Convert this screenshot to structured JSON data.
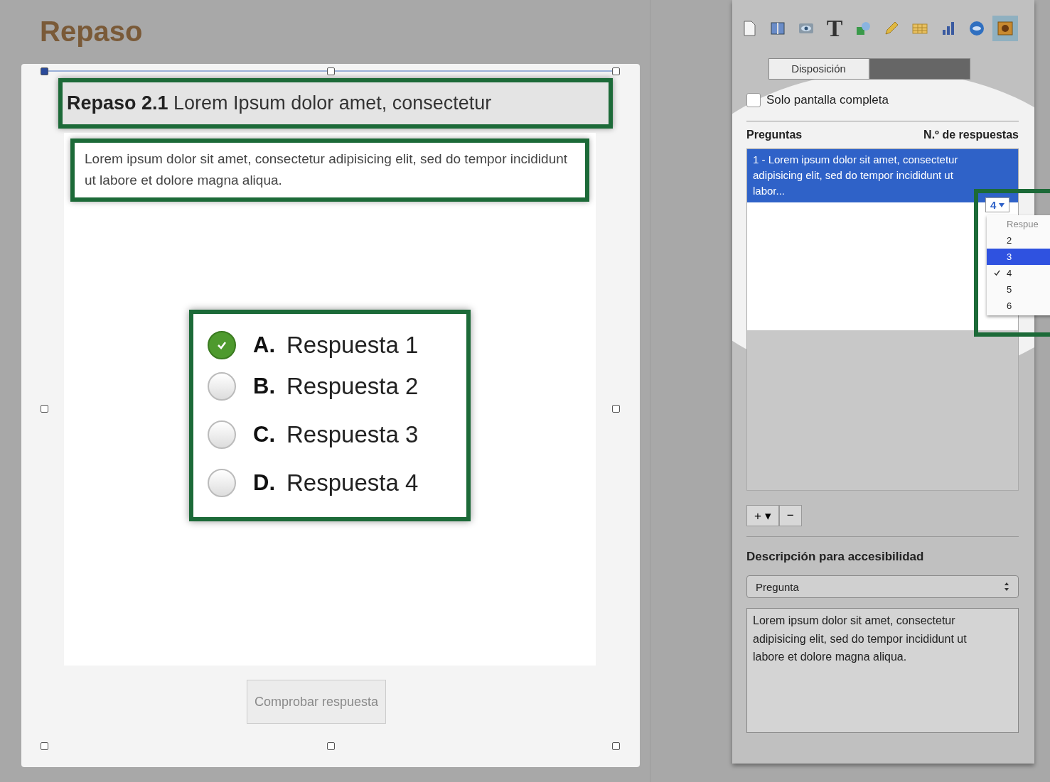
{
  "document": {
    "title": "Repaso",
    "heading": {
      "prefix": "Repaso 2.1",
      "text": "Lorem Ipsum dolor amet, consectetur"
    },
    "intro": "Lorem ipsum dolor sit amet, consectetur adipisicing elit, sed do tempor incididunt ut labore et dolore magna aliqua.",
    "answers": [
      {
        "letter": "A.",
        "text": "Respuesta 1",
        "selected": true
      },
      {
        "letter": "B.",
        "text": "Respuesta 2",
        "selected": false
      },
      {
        "letter": "C.",
        "text": "Respuesta 3",
        "selected": false
      },
      {
        "letter": "D.",
        "text": "Respuesta 4",
        "selected": false
      }
    ],
    "check_button": "Comprobar respuesta"
  },
  "inspector": {
    "toolbar": [
      {
        "kind": "page",
        "selected": false
      },
      {
        "kind": "book",
        "selected": false
      },
      {
        "kind": "eye",
        "selected": false
      },
      {
        "kind": "text",
        "glyph": "T",
        "selected": false
      },
      {
        "kind": "shapes",
        "selected": false
      },
      {
        "kind": "pencil",
        "selected": false
      },
      {
        "kind": "table",
        "selected": false
      },
      {
        "kind": "chart",
        "selected": false
      },
      {
        "kind": "globe",
        "selected": false
      },
      {
        "kind": "widget",
        "selected": true
      }
    ],
    "tabs": [
      {
        "label": "Disposición",
        "selected": false
      },
      {
        "selected": true
      }
    ],
    "fullscreen_only": {
      "label": "Solo pantalla completa",
      "checked": false
    },
    "questions": {
      "columns": [
        "Preguntas",
        "N.º de respuestas"
      ],
      "rows": [
        {
          "text": "1 - Lorem ipsum dolor sit amet, consectetur adipisicing elit, sed do tempor incididunt ut labor...",
          "count": "4",
          "selected": true
        }
      ]
    },
    "count_menu": {
      "items": [
        {
          "label": "Respue",
          "kind": "header"
        },
        {
          "label": "2",
          "kind": "option",
          "checked": false,
          "selected": false
        },
        {
          "label": "3",
          "kind": "option",
          "checked": false,
          "selected": true
        },
        {
          "label": "4",
          "kind": "option",
          "checked": true,
          "selected": false
        },
        {
          "label": "5",
          "kind": "option",
          "checked": false,
          "selected": false
        },
        {
          "label": "6",
          "kind": "option",
          "checked": false,
          "selected": false
        }
      ]
    },
    "add_button": "+ ▾",
    "remove_button": "−",
    "accessibility": {
      "label": "Descripción para accesibilidad",
      "popup": "Pregunta",
      "text": "Lorem ipsum dolor sit amet, consectetur adipisicing elit, sed do tempor incididunt ut labore et dolore magna aliqua."
    }
  }
}
